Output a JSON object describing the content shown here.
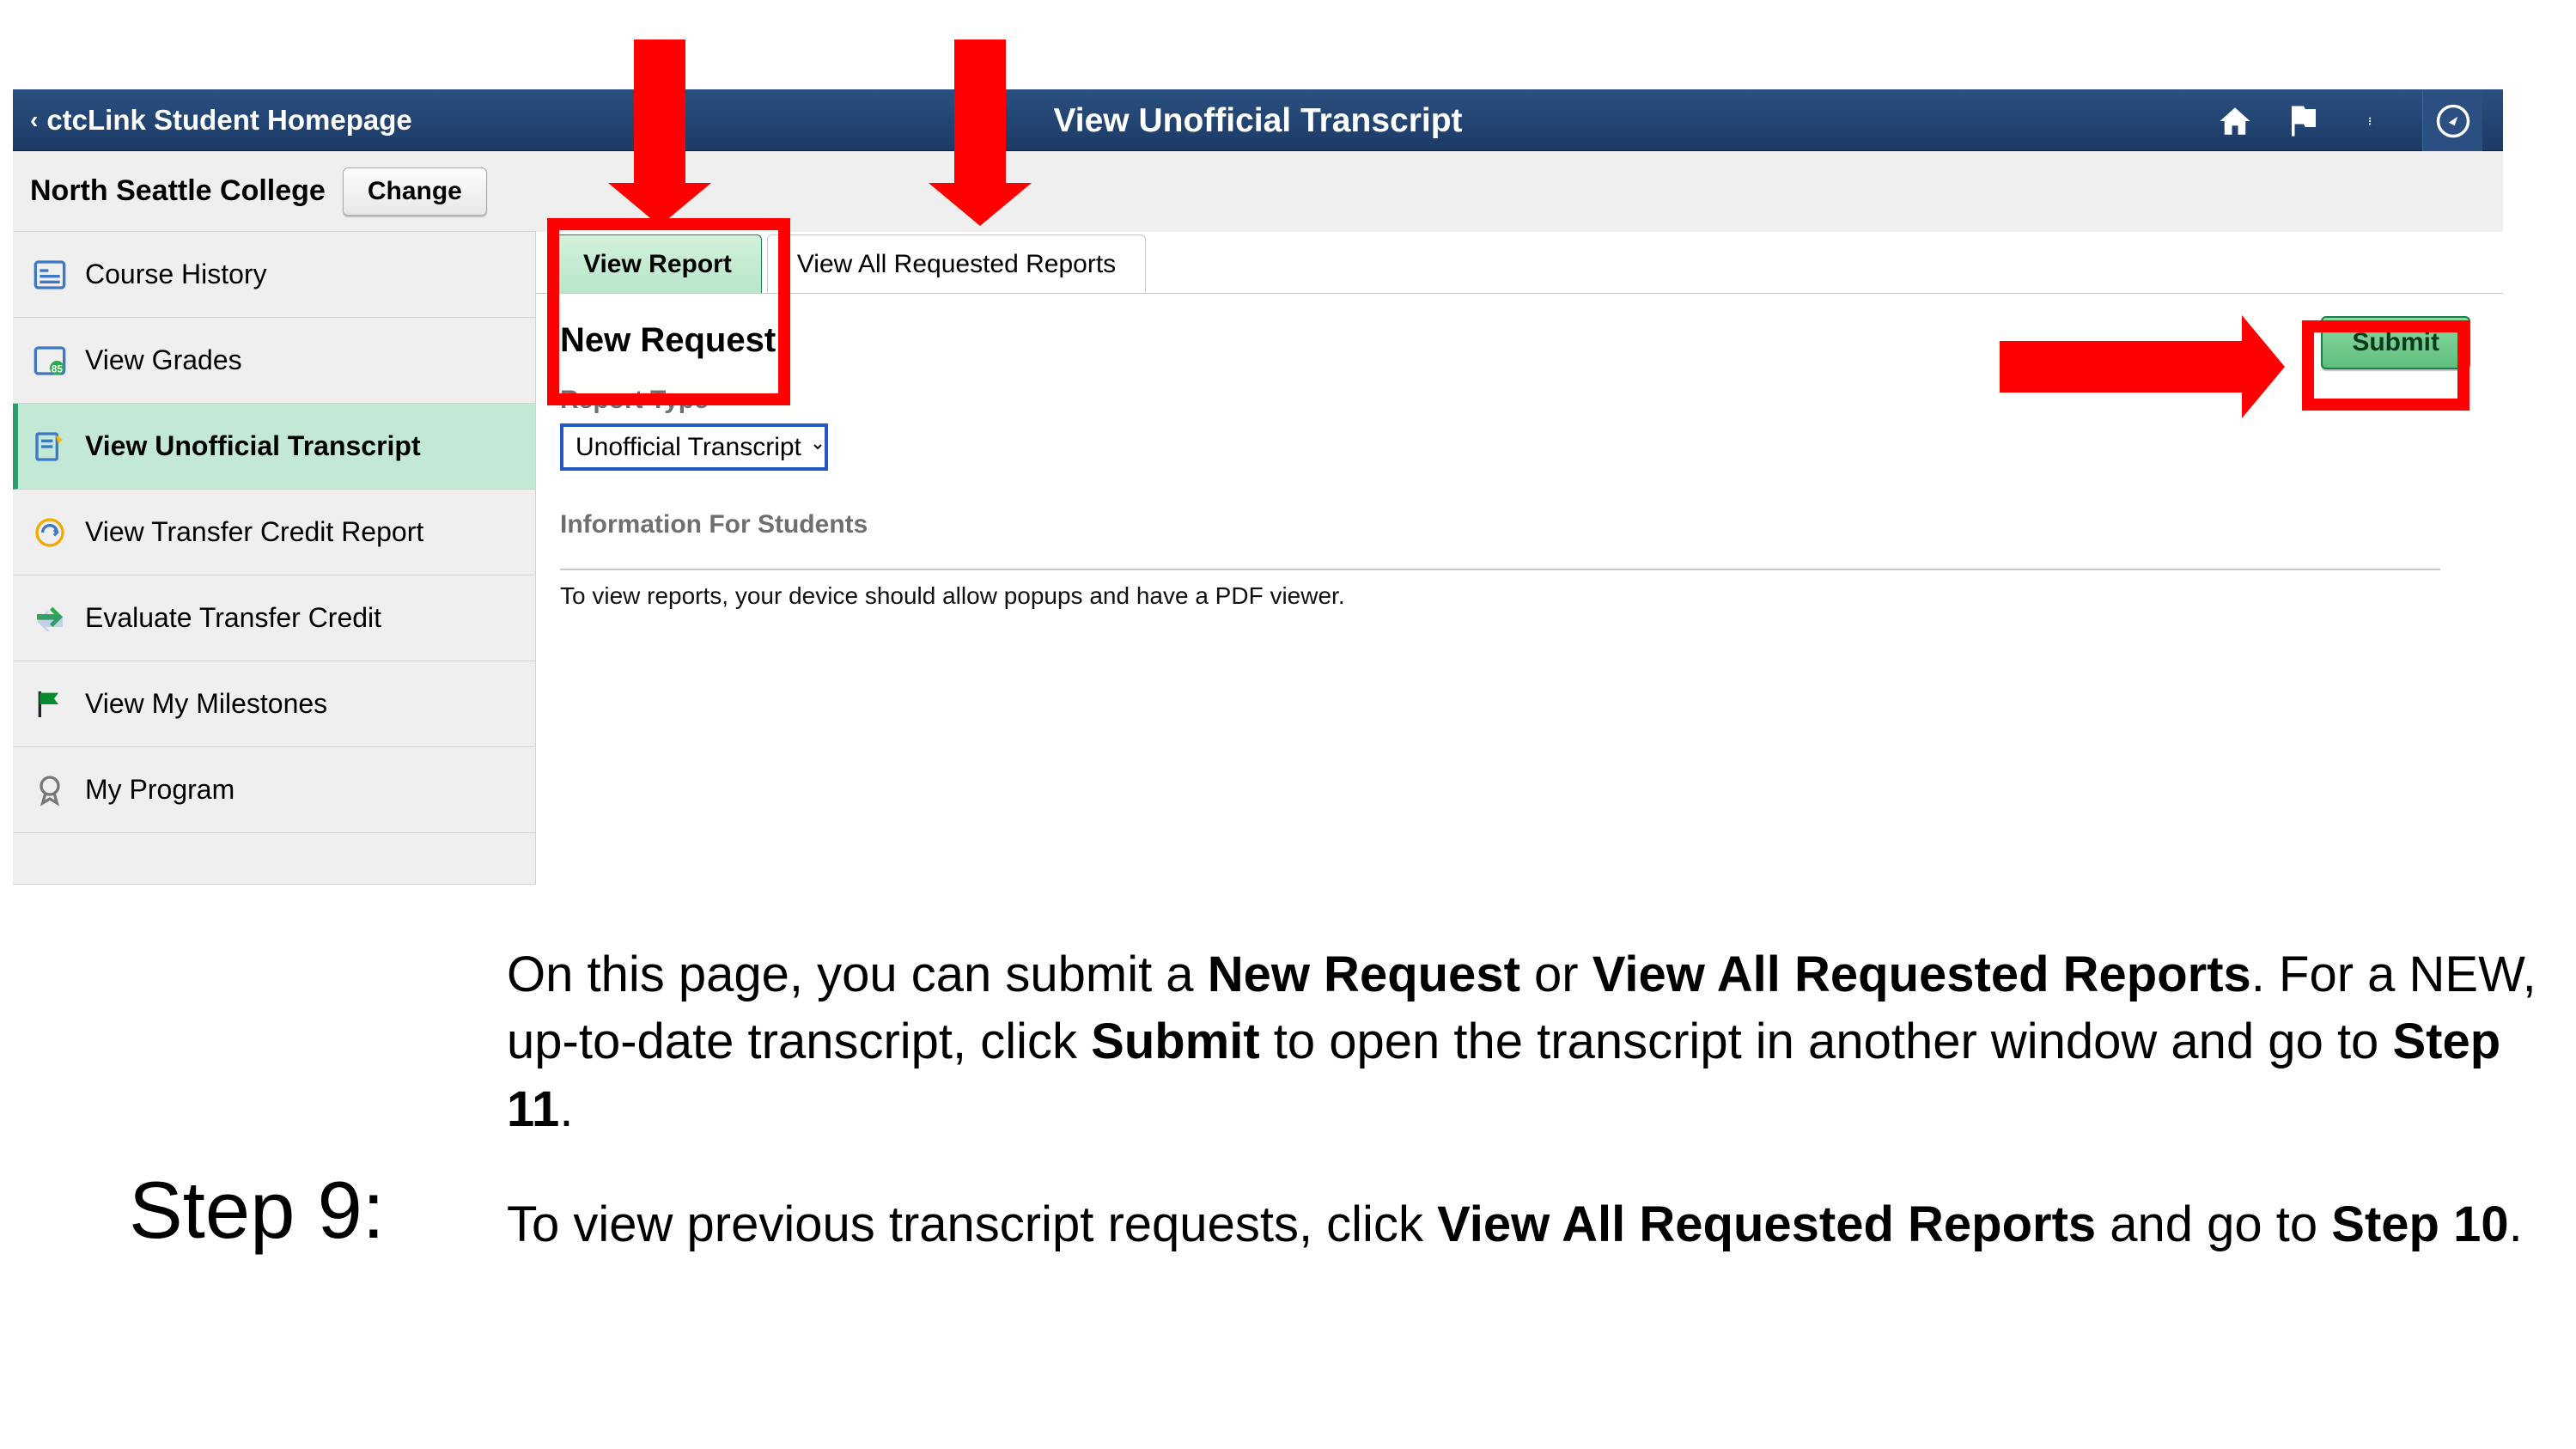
{
  "header": {
    "back_label": "ctcLink Student Homepage",
    "title": "View Unofficial Transcript"
  },
  "subheader": {
    "college_name": "North Seattle College",
    "change_label": "Change"
  },
  "sidebar": {
    "items": [
      {
        "label": "Course History"
      },
      {
        "label": "View Grades"
      },
      {
        "label": "View Unofficial Transcript"
      },
      {
        "label": "View Transfer Credit Report"
      },
      {
        "label": "Evaluate Transfer Credit"
      },
      {
        "label": "View My Milestones"
      },
      {
        "label": "My Program"
      }
    ]
  },
  "main": {
    "tabs": [
      {
        "label": "View Report"
      },
      {
        "label": "View All Requested Reports"
      }
    ],
    "heading": "New Request",
    "report_type_label": "Report Type",
    "report_type_value": "Unofficial Transcript",
    "info_heading": "Information For Students",
    "info_note": "To view reports, your device should allow popups and have a PDF viewer.",
    "submit_label": "Submit"
  },
  "instructions": {
    "step_label": "Step 9:",
    "p1_a": "On this page, you can submit a ",
    "p1_b": "New Request",
    "p1_c": " or ",
    "p1_d": "View All Requested Reports",
    "p1_e": ". For a NEW, up-to-date transcript, click ",
    "p1_f": "Submit",
    "p1_g": " to open the transcript in another window and go to ",
    "p1_h": "Step 11",
    "p1_i": ".",
    "p2_a": "To view previous transcript requests, click ",
    "p2_b": "View All Requested Reports",
    "p2_c": " and go to ",
    "p2_d": "Step 10",
    "p2_e": "."
  }
}
